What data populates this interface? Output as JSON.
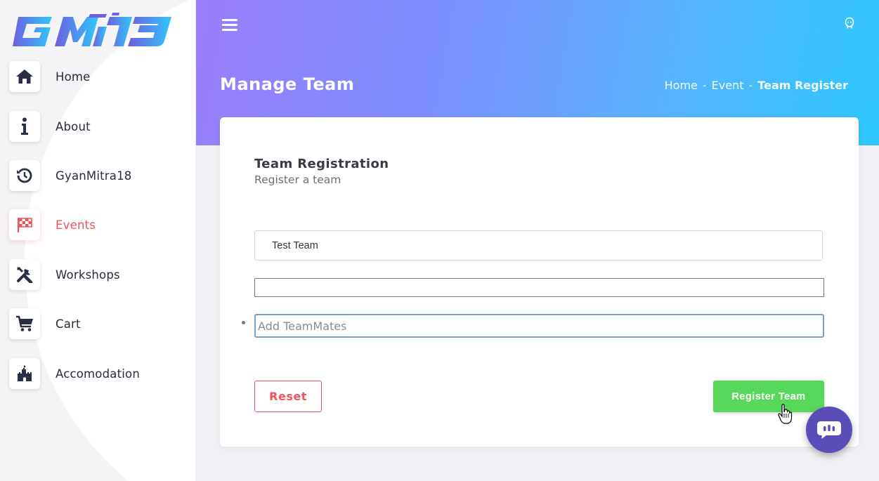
{
  "sidebar": {
    "logo_text": "GyanMitra19",
    "items": [
      {
        "label": "Home",
        "icon": "home-icon"
      },
      {
        "label": "About",
        "icon": "info-icon"
      },
      {
        "label": "GyanMitra18",
        "icon": "history-icon"
      },
      {
        "label": "Events",
        "icon": "checkered-flag-icon",
        "active": true
      },
      {
        "label": "Workshops",
        "icon": "tools-icon"
      },
      {
        "label": "Cart",
        "icon": "cart-icon"
      },
      {
        "label": "Accomodation",
        "icon": "castle-icon"
      }
    ]
  },
  "header": {
    "title": "Manage Team",
    "breadcrumb": [
      "Home",
      "Event",
      "Team Register"
    ],
    "separator": "-"
  },
  "form": {
    "title": "Team Registration",
    "subtitle": "Register a team",
    "team_name_value": "Test Team",
    "teammates_placeholder": "Add TeamMates",
    "reset_label": "Reset",
    "register_label": "Register Team"
  },
  "colors": {
    "accent_red": "#f0535f",
    "register_green": "#58d85a",
    "chat_purple": "#5a4db8",
    "header_gradient_start": "#9b7dfa",
    "header_gradient_end": "#2ec7fd"
  }
}
